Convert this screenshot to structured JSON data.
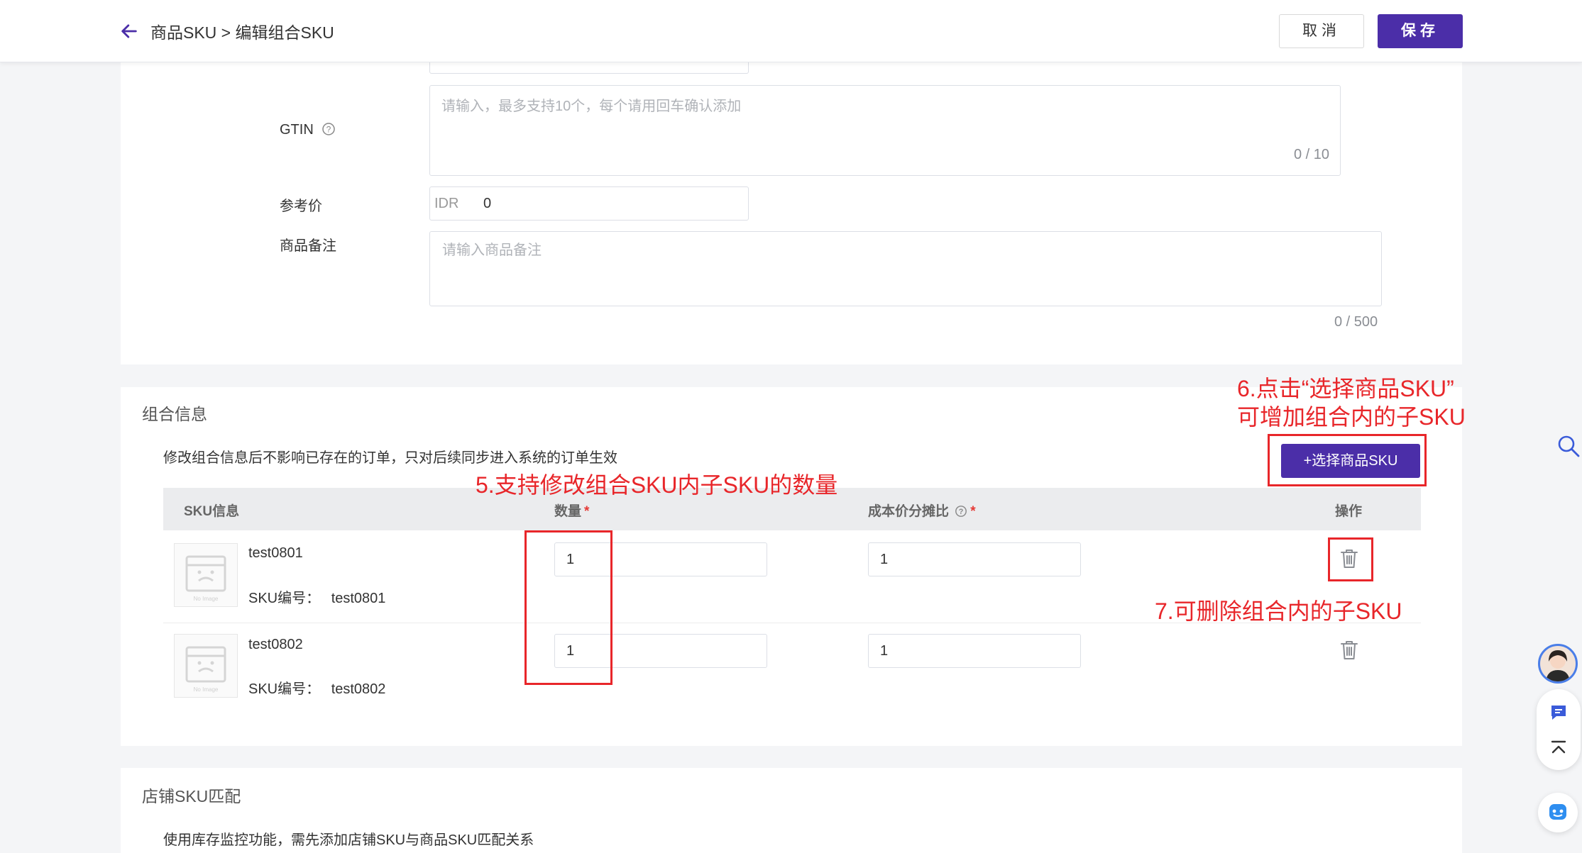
{
  "header": {
    "breadcrumb": "商品SKU > 编辑组合SKU",
    "cancel_label": "取消",
    "save_label": "保存"
  },
  "form": {
    "gtin": {
      "label": "GTIN",
      "placeholder": "请输入，最多支持10个，每个请用回车确认添加",
      "counter": "0 / 10"
    },
    "reference_price": {
      "label": "参考价",
      "currency": "IDR",
      "value": "0"
    },
    "remark": {
      "label": "商品备注",
      "placeholder": "请输入商品备注",
      "counter": "0 / 500"
    }
  },
  "combo": {
    "title": "组合信息",
    "description": "修改组合信息后不影响已存在的订单，只对后续同步进入系统的订单生效",
    "select_button": "+选择商品SKU",
    "columns": {
      "sku_info": "SKU信息",
      "quantity": "数量",
      "cost_ratio": "成本价分摊比",
      "actions": "操作"
    },
    "required_mark": "*",
    "rows": [
      {
        "name": "test0801",
        "code_label": "SKU编号：",
        "code": "test0801",
        "quantity": "1",
        "cost_ratio": "1"
      },
      {
        "name": "test0802",
        "code_label": "SKU编号：",
        "code": "test0802",
        "quantity": "1",
        "cost_ratio": "1"
      }
    ],
    "no_image_text": "No Image"
  },
  "store_match": {
    "title": "店铺SKU匹配",
    "description": "使用库存监控功能，需先添加店铺SKU与商品SKU匹配关系"
  },
  "annotations": {
    "step5": "5.支持修改组合SKU内子SKU的数量",
    "step6_line1": "6.点击“选择商品SKU”",
    "step6_line2": "可增加组合内的子SKU",
    "step7": "7.可删除组合内的子SKU"
  },
  "colors": {
    "primary": "#4b2ea8",
    "annotation": "#e8262a",
    "required": "#e53935"
  }
}
